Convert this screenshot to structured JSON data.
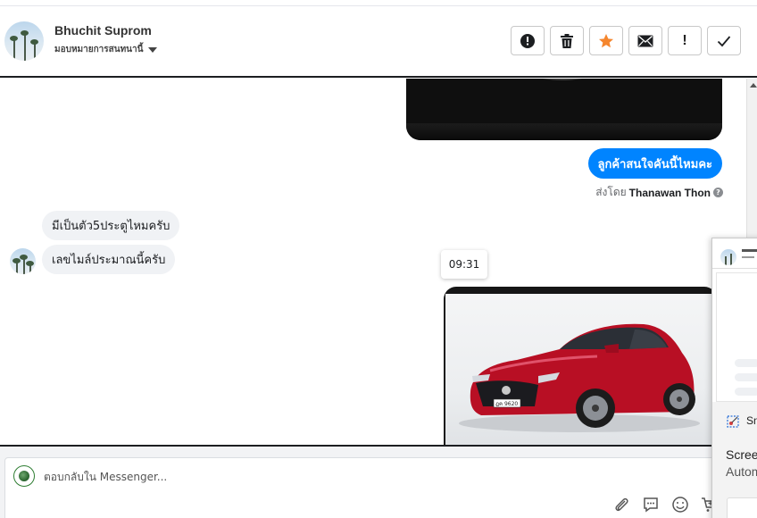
{
  "header": {
    "contact_name": "Bhuchit Suprom",
    "assign_label": "มอบหมายการสนทนานี้",
    "actions": [
      {
        "name": "spam-button",
        "icon": "alert-circle-icon"
      },
      {
        "name": "delete-button",
        "icon": "trash-icon"
      },
      {
        "name": "star-button",
        "icon": "star-icon"
      },
      {
        "name": "mark-unread-button",
        "icon": "envelope-icon"
      },
      {
        "name": "follow-up-button",
        "label": "!"
      },
      {
        "name": "done-button",
        "icon": "check-icon"
      }
    ]
  },
  "messages": {
    "outgoing_text": "ลูกค้าสนใจคันนี้ไหมคะ",
    "sent_by_prefix": "ส่งโดย",
    "sent_by_name": "Thanawan Thon",
    "incoming": [
      "มีเป็นตัว5ประตูไหมครับ",
      "เลขไมล์ประมาณนี้ครับ"
    ],
    "timestamp": "09:31"
  },
  "reply": {
    "placeholder": "ตอบกลับใน Messenger..."
  },
  "overlay": {
    "snip_label": "Sn",
    "line1": "Screen",
    "line2": "Autom"
  },
  "colors": {
    "messenger_blue": "#0084ff",
    "incoming_bubble": "#f0f2f5",
    "star_orange": "#f5862e",
    "car_red": "#c8102e"
  }
}
